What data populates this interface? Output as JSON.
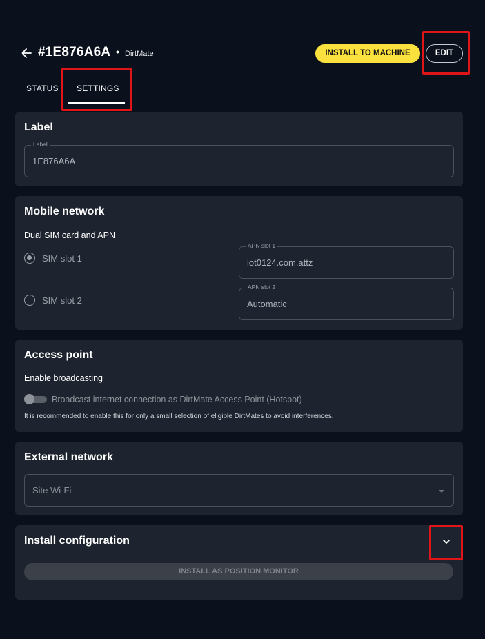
{
  "header": {
    "device_id": "#1E876A6A",
    "separator": "•",
    "device_type": "DirtMate",
    "install_button_label": "INSTALL TO MACHINE",
    "edit_button_label": "EDIT"
  },
  "tabs": [
    {
      "label": "STATUS",
      "active": false
    },
    {
      "label": "SETTINGS",
      "active": true
    }
  ],
  "label_card": {
    "title": "Label",
    "field_legend": "Label",
    "field_value": "1E876A6A"
  },
  "mobile_network_card": {
    "title": "Mobile network",
    "subtitle": "Dual SIM card and APN",
    "sim_slots": [
      {
        "label": "SIM slot 1",
        "checked": true
      },
      {
        "label": "SIM slot 2",
        "checked": false
      }
    ],
    "apn_slots": [
      {
        "legend": "APN slot 1",
        "value": "iot0124.com.attz"
      },
      {
        "legend": "APN slot 2",
        "value": "Automatic"
      }
    ]
  },
  "access_point_card": {
    "title": "Access point",
    "subtitle": "Enable broadcasting",
    "toggle_label": "Broadcast internet connection as DirtMate Access Point (Hotspot)",
    "toggle_on": false,
    "helper_text": "It is recommended to enable this for only a small selection of eligible DirtMates to avoid interferences."
  },
  "external_network_card": {
    "title": "External network",
    "select_value": "Site Wi-Fi"
  },
  "install_config_card": {
    "title": "Install configuration",
    "button_label": "INSTALL AS POSITION MONITOR"
  },
  "colors": {
    "background": "#0b111c",
    "card": "#1e242f",
    "accent_yellow": "#fbe13d",
    "highlight_red": "#e0151a"
  }
}
